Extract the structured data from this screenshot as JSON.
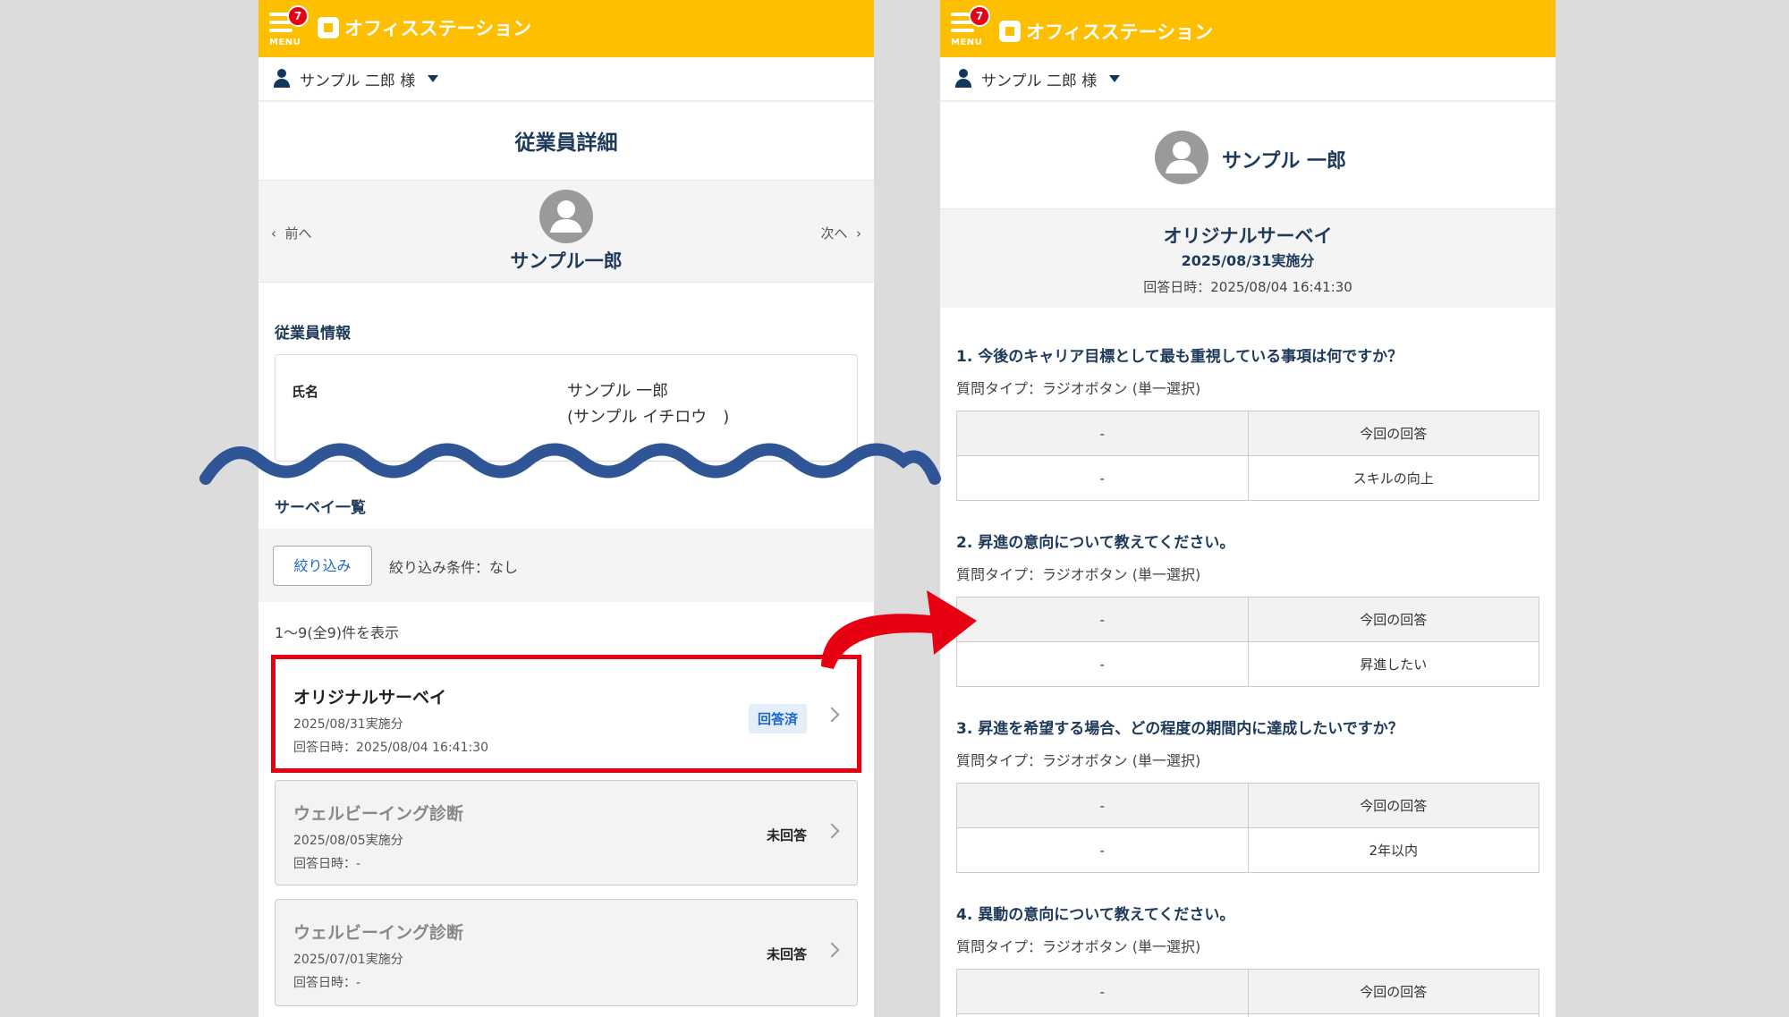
{
  "app": {
    "logo_text": "オフィスステーション",
    "menu_label": "MENU",
    "notification_count": "7",
    "user_name": "サンプル 二郎 様"
  },
  "left": {
    "page_title": "従業員詳細",
    "prev_label": "前へ",
    "next_label": "次へ",
    "employee_name": "サンプル一郎",
    "section_info": "従業員情報",
    "info_key": "氏名",
    "info_name": "サンプル 一郎",
    "info_kana": "(サンプル イチロウ　)",
    "section_surveys": "サーベイ一覧",
    "filter_button": "絞り込み",
    "filter_condition": "絞り込み条件：なし",
    "count_text": "1〜9(全9)件を表示",
    "surveys": [
      {
        "title": "オリジナルサーベイ",
        "date": "2025/08/31実施分",
        "answered": "回答日時：2025/08/04 16:41:30",
        "status": "回答済"
      },
      {
        "title": "ウェルビーイング診断",
        "date": "2025/08/05実施分",
        "answered": "回答日時：-",
        "status": "未回答"
      },
      {
        "title": "ウェルビーイング診断",
        "date": "2025/07/01実施分",
        "answered": "回答日時：-",
        "status": "未回答"
      }
    ]
  },
  "right": {
    "profile_name": "サンプル 一郎",
    "survey_title": "オリジナルサーベイ",
    "survey_date": "2025/08/31実施分",
    "survey_answered": "回答日時：2025/08/04 16:41:30",
    "questions": [
      {
        "text": "1.  今後のキャリア目標として最も重視している事項は何ですか？",
        "type": "質問タイプ：ラジオボタン (単一選択)",
        "col1": "-",
        "col2": "今回の回答",
        "ans1": "-",
        "ans2": "スキルの向上"
      },
      {
        "text": "2.  昇進の意向について教えてください。",
        "type": "質問タイプ：ラジオボタン (単一選択)",
        "col1": "-",
        "col2": "今回の回答",
        "ans1": "-",
        "ans2": "昇進したい"
      },
      {
        "text": "3.  昇進を希望する場合、どの程度の期間内に達成したいですか？",
        "type": "質問タイプ：ラジオボタン (単一選択)",
        "col1": "-",
        "col2": "今回の回答",
        "ans1": "-",
        "ans2": "2年以内"
      },
      {
        "text": "4.  異動の意向について教えてください。",
        "type": "質問タイプ：ラジオボタン (単一選択)",
        "col1": "-",
        "col2": "今回の回答"
      }
    ]
  },
  "colors": {
    "brand": "#fdbf00",
    "highlight": "#e60012",
    "wave": "#2f5597",
    "navy": "#1e3a5a"
  }
}
